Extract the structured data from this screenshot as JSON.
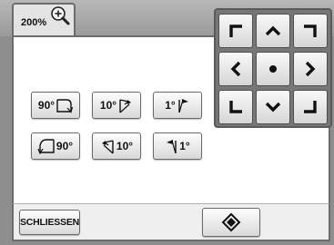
{
  "zoom": {
    "label": "200%",
    "icon": "zoom-in-magnifier-icon"
  },
  "rotate_buttons": {
    "cw_90": {
      "label": "90°",
      "icon": "rotate-clockwise-corner-icon"
    },
    "cw_10": {
      "label": "10°",
      "icon": "rotate-clockwise-flag-icon"
    },
    "cw_1": {
      "label": "1°",
      "icon": "rotate-clockwise-small-flag-icon"
    },
    "ccw_90": {
      "label": "90°",
      "icon": "rotate-counterclockwise-corner-icon"
    },
    "ccw_10": {
      "label": "10°",
      "icon": "rotate-counterclockwise-flag-icon"
    },
    "ccw_1": {
      "label": "1°",
      "icon": "rotate-counterclockwise-small-flag-icon"
    }
  },
  "dpad": {
    "keys": [
      {
        "name": "up-left",
        "icon": "corner-top-left-icon"
      },
      {
        "name": "up",
        "icon": "chevron-up-icon"
      },
      {
        "name": "up-right",
        "icon": "corner-top-right-icon"
      },
      {
        "name": "left",
        "icon": "chevron-left-icon"
      },
      {
        "name": "center",
        "icon": "center-dot-icon"
      },
      {
        "name": "right",
        "icon": "chevron-right-icon"
      },
      {
        "name": "down-left",
        "icon": "corner-bottom-left-icon"
      },
      {
        "name": "down",
        "icon": "chevron-down-icon"
      },
      {
        "name": "down-right",
        "icon": "corner-bottom-right-icon"
      }
    ]
  },
  "footer": {
    "close_label": "SCHLIESSEN",
    "ok_icon": "rotate-confirm-diamond-icon"
  },
  "colors": {
    "background": "#8e8e8e",
    "panel": "#ffffff",
    "button_border": "#6a6a6a",
    "dpad_frame": "#777777"
  }
}
